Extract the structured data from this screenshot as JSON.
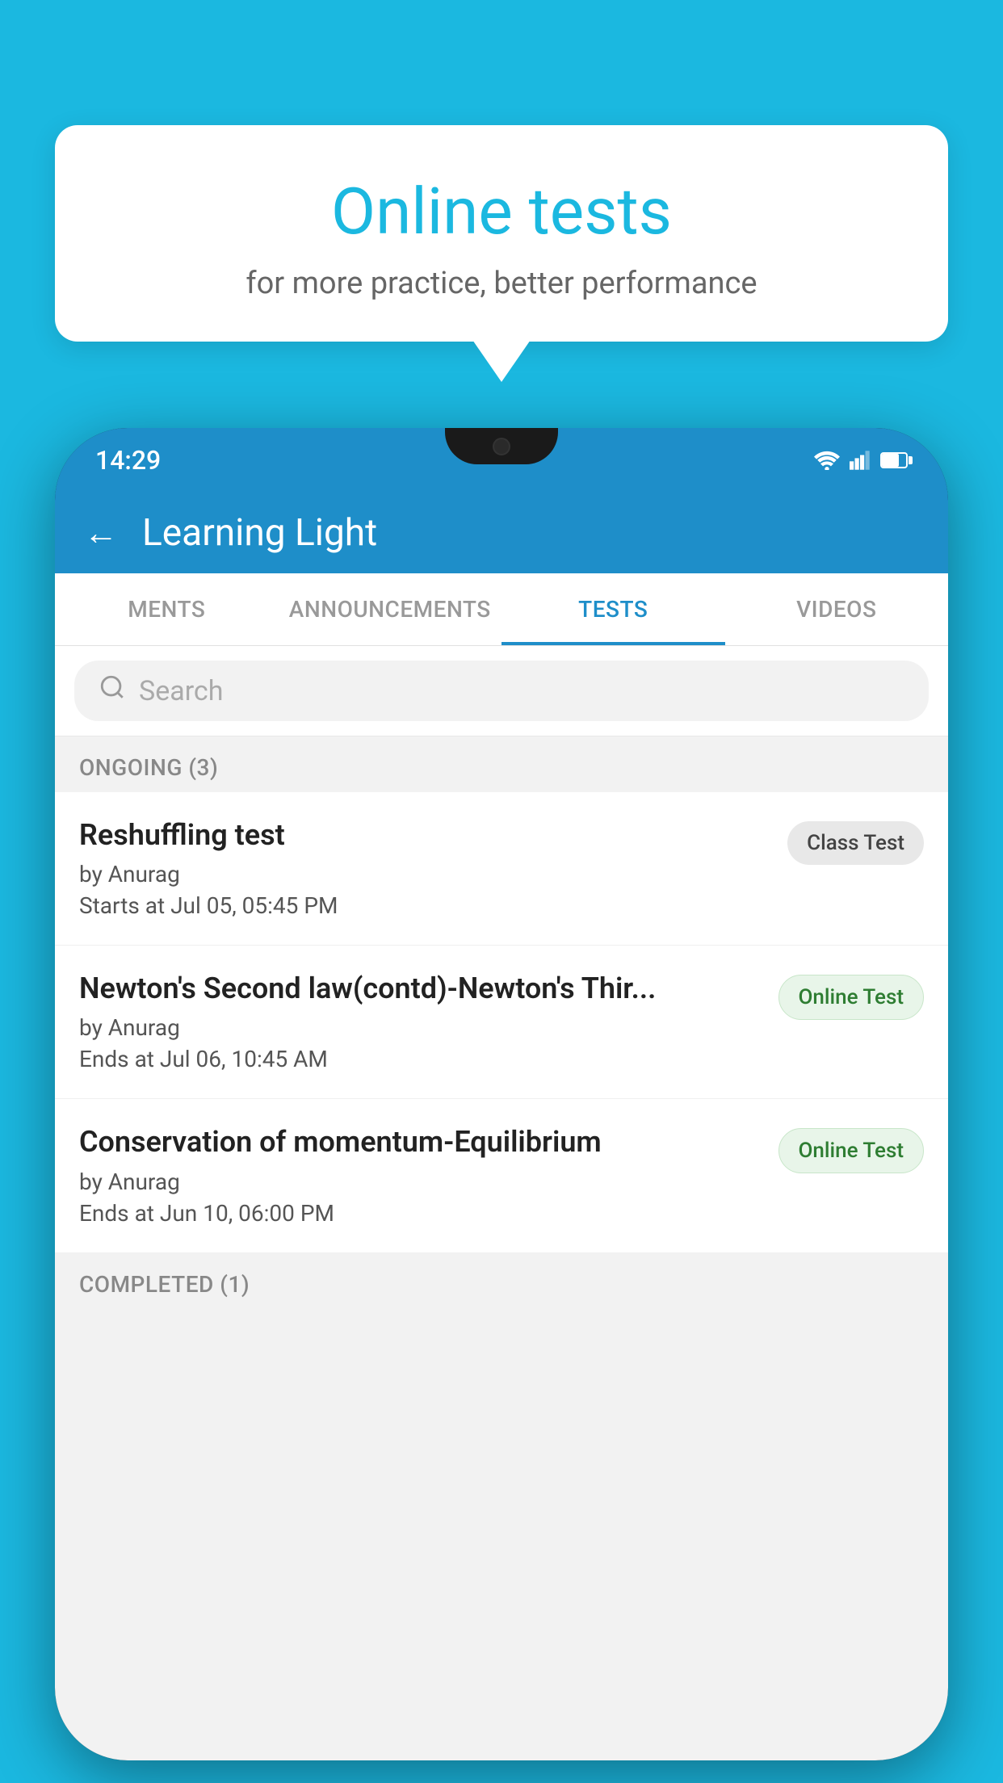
{
  "background": {
    "color": "#1bb8e0"
  },
  "speech_bubble": {
    "title": "Online tests",
    "subtitle": "for more practice, better performance"
  },
  "phone": {
    "status_bar": {
      "time": "14:29",
      "wifi": "▼",
      "signal": "◀",
      "battery": "▉"
    },
    "app_header": {
      "back_label": "←",
      "title": "Learning Light"
    },
    "tabs": [
      {
        "label": "MENTS",
        "active": false
      },
      {
        "label": "ANNOUNCEMENTS",
        "active": false
      },
      {
        "label": "TESTS",
        "active": true
      },
      {
        "label": "VIDEOS",
        "active": false
      }
    ],
    "search": {
      "placeholder": "Search"
    },
    "sections": [
      {
        "header": "ONGOING (3)",
        "items": [
          {
            "name": "Reshuffling test",
            "author": "by Anurag",
            "time_label": "Starts at",
            "time": "Jul 05, 05:45 PM",
            "badge": "Class Test",
            "badge_type": "class"
          },
          {
            "name": "Newton's Second law(contd)-Newton's Thir...",
            "author": "by Anurag",
            "time_label": "Ends at",
            "time": "Jul 06, 10:45 AM",
            "badge": "Online Test",
            "badge_type": "online"
          },
          {
            "name": "Conservation of momentum-Equilibrium",
            "author": "by Anurag",
            "time_label": "Ends at",
            "time": "Jun 10, 06:00 PM",
            "badge": "Online Test",
            "badge_type": "online"
          }
        ]
      },
      {
        "header": "COMPLETED (1)",
        "items": []
      }
    ]
  }
}
